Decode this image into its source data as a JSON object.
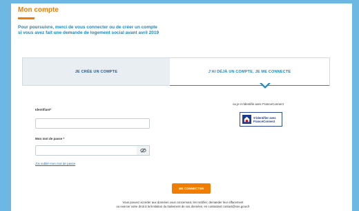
{
  "header": {
    "title": "Mon compte"
  },
  "intro": {
    "line1": "Pour poursuivre, merci de vous connecter ou de créer un compte",
    "line2": "si vous avez fait une demande de logement social avant avril 2019"
  },
  "tabs": [
    {
      "label": "JE CRÉE UN COMPTE",
      "active": false
    },
    {
      "label": "J'AI DÉJÀ UN COMPTE, JE ME CONNECTE",
      "active": true
    }
  ],
  "login_form": {
    "identifier_label": "Identifiant*",
    "identifier_value": "",
    "password_label": "Mon mot de passe *",
    "password_value": "",
    "password_toggle_icon": "eye-slash-icon",
    "forgot_link": "J'ai oublié mon mot de passe",
    "submit_label": "ME CONNECTER"
  },
  "franceconnect": {
    "text": "ou je m'identifie avec FranceConnect",
    "button_line1": "S'identifier avec",
    "button_line2": "FranceConnect",
    "icon": "franceconnect-logo-icon"
  },
  "footer": {
    "line1": "Vous pouvez accéder aux données vous concernant, les rectifier, demander leur effacement",
    "line2": "ou exercer votre droit à la limitation du traitement de vos données, en contactant contact@sne.gouv.fr"
  },
  "colors": {
    "accent": "#f07d00",
    "primary": "#1b87c4",
    "background": "#6db8e3"
  }
}
